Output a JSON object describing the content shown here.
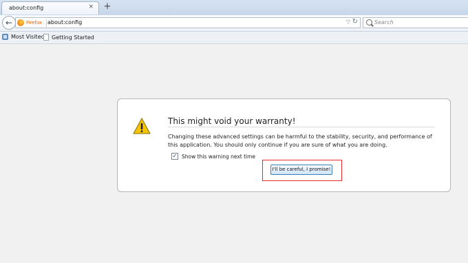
{
  "tab": {
    "title": "about:config",
    "close_glyph": "×",
    "new_tab_glyph": "+"
  },
  "navbar": {
    "back_glyph": "←",
    "identity_label": "Firefox",
    "url": "about:config",
    "dropdown_glyph": "▽",
    "reload_glyph": "↻",
    "search_placeholder": "Search"
  },
  "bookmarks": {
    "items": [
      {
        "label": "Most Visited",
        "icon": "bookmarks-folder-icon"
      },
      {
        "label": "Getting Started",
        "icon": "page-icon"
      }
    ]
  },
  "warning": {
    "icon": "warning-icon",
    "title": "This might void your warranty!",
    "message": "Changing these advanced settings can be harmful to the stability, security, and performance of this application. You should only continue if you are sure of what you are doing.",
    "checkbox_label": "Show this warning next time",
    "checkbox_checked": true,
    "checkbox_glyph": "✓",
    "confirm_button": "I'll be careful, I promise!",
    "highlight_color": "#e32b2b",
    "icon_color": "#f3c400"
  }
}
